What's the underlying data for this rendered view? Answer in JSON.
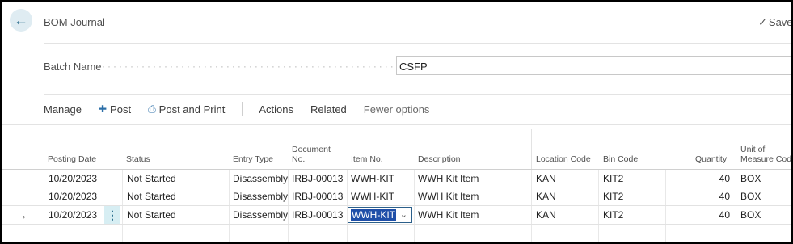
{
  "header": {
    "title": "BOM Journal",
    "saved_label": "Saved",
    "back_icon": "arrow-left-icon",
    "saved_icon": "checkmark-icon"
  },
  "batch": {
    "label": "Batch Name",
    "value": "CSFP"
  },
  "actions": {
    "manage": "Manage",
    "post": "Post",
    "post_and_print": "Post and Print",
    "actions": "Actions",
    "related": "Related",
    "fewer_options": "Fewer options"
  },
  "columns": {
    "posting_date": "Posting Date",
    "status": "Status",
    "entry_type": "Entry Type",
    "document_no_1": "Document",
    "document_no_2": "No.",
    "item_no": "Item No.",
    "description": "Description",
    "location_code": "Location Code",
    "bin_code": "Bin Code",
    "quantity": "Quantity",
    "uom_1": "Unit of",
    "uom_2": "Measure Code"
  },
  "rows": [
    {
      "posting_date": "10/20/2023",
      "status": "Not Started",
      "entry_type": "Disassembly",
      "document_no": "IRBJ-00013",
      "item_no": "WWH-KIT",
      "description": "WWH Kit Item",
      "location_code": "KAN",
      "bin_code": "KIT2",
      "quantity": "40",
      "uom": "BOX"
    },
    {
      "posting_date": "10/20/2023",
      "status": "Not Started",
      "entry_type": "Disassembly",
      "document_no": "IRBJ-00013",
      "item_no": "WWH-KIT",
      "description": "WWH Kit Item",
      "location_code": "KAN",
      "bin_code": "KIT2",
      "quantity": "40",
      "uom": "BOX"
    },
    {
      "posting_date": "10/20/2023",
      "status": "Not Started",
      "entry_type": "Disassembly",
      "document_no": "IRBJ-00013",
      "item_no": "WWH-KIT",
      "description": "WWH Kit Item",
      "location_code": "KAN",
      "bin_code": "KIT2",
      "quantity": "40",
      "uom": "BOX"
    }
  ],
  "colors": {
    "accent": "#2c6fa8",
    "selection": "#1f4fa8",
    "active_cell": "#d7eef3"
  }
}
